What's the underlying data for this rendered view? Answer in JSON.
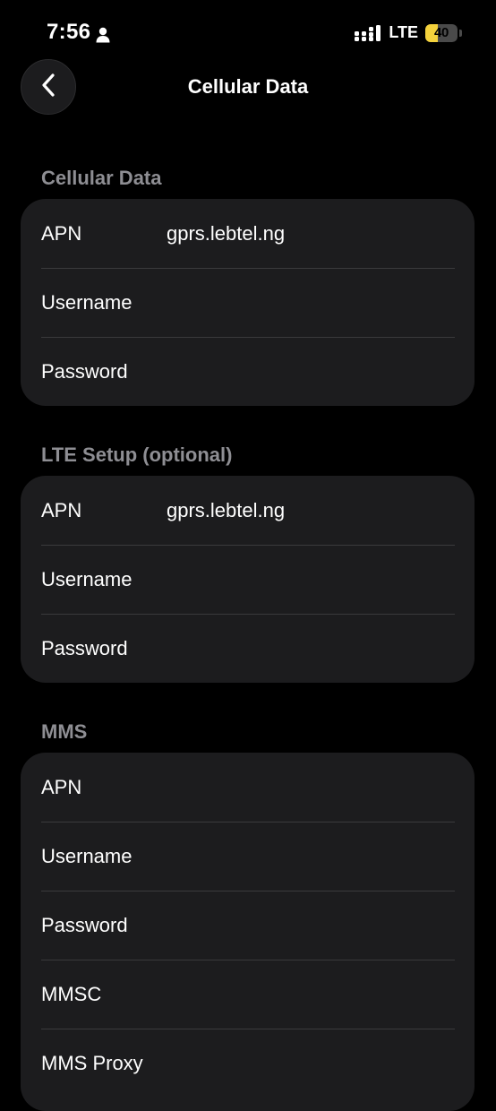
{
  "status": {
    "time": "7:56",
    "network": "LTE",
    "battery_percent": "40",
    "battery_level": 0.4,
    "battery_color": "#f4d23c"
  },
  "nav": {
    "title": "Cellular Data"
  },
  "sections": [
    {
      "header": "Cellular Data",
      "rows": [
        {
          "label": "APN",
          "value": "gprs.lebtel.ng"
        },
        {
          "label": "Username",
          "value": ""
        },
        {
          "label": "Password",
          "value": ""
        }
      ]
    },
    {
      "header": "LTE Setup (optional)",
      "rows": [
        {
          "label": "APN",
          "value": "gprs.lebtel.ng"
        },
        {
          "label": "Username",
          "value": ""
        },
        {
          "label": "Password",
          "value": ""
        }
      ]
    },
    {
      "header": "MMS",
      "rows": [
        {
          "label": "APN",
          "value": ""
        },
        {
          "label": "Username",
          "value": ""
        },
        {
          "label": "Password",
          "value": ""
        },
        {
          "label": "MMSC",
          "value": ""
        },
        {
          "label": "MMS Proxy",
          "value": ""
        }
      ]
    }
  ]
}
